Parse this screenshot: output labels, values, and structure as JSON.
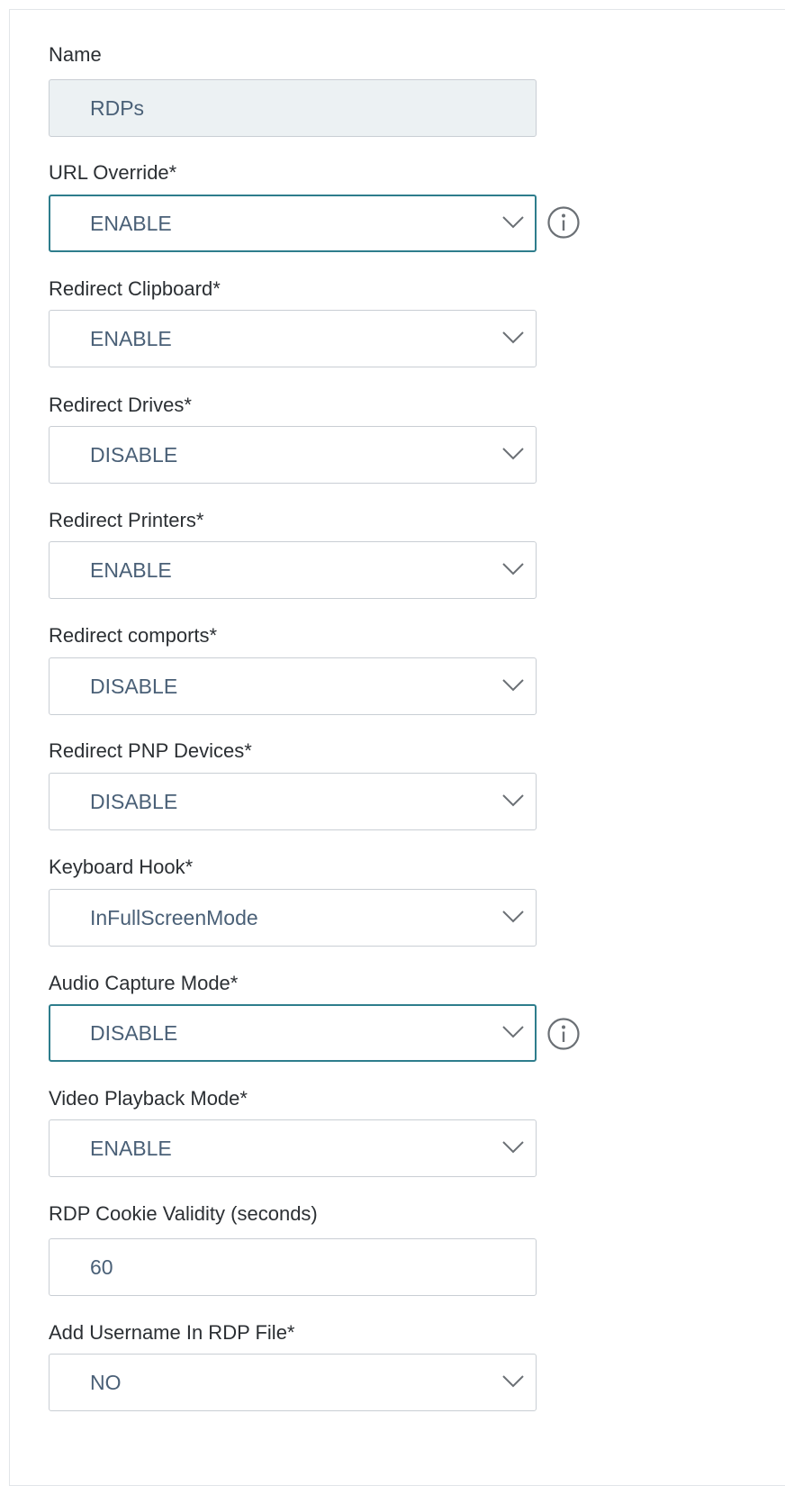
{
  "form": {
    "name": {
      "label": "Name",
      "value": "RDPs"
    },
    "url_override": {
      "label": "URL Override*",
      "value": "ENABLE"
    },
    "redirect_clipboard": {
      "label": "Redirect Clipboard*",
      "value": "ENABLE"
    },
    "redirect_drives": {
      "label": "Redirect Drives*",
      "value": "DISABLE"
    },
    "redirect_printers": {
      "label": "Redirect Printers*",
      "value": "ENABLE"
    },
    "redirect_comports": {
      "label": "Redirect comports*",
      "value": "DISABLE"
    },
    "redirect_pnp_devices": {
      "label": "Redirect PNP Devices*",
      "value": "DISABLE"
    },
    "keyboard_hook": {
      "label": "Keyboard Hook*",
      "value": "InFullScreenMode"
    },
    "audio_capture_mode": {
      "label": "Audio Capture Mode*",
      "value": "DISABLE"
    },
    "video_playback_mode": {
      "label": "Video Playback Mode*",
      "value": "ENABLE"
    },
    "rdp_cookie_validity": {
      "label": "RDP Cookie Validity (seconds)",
      "value": "60"
    },
    "add_username_in_rdp_file": {
      "label": "Add Username In RDP File*",
      "value": "NO"
    }
  },
  "icons": {
    "dropdown": "chevron-down-icon",
    "help": "info-icon"
  },
  "colors": {
    "focus_border": "#2e7d8c",
    "value_text": "#4a6077",
    "label_text": "#2b2f33",
    "readonly_bg": "#ecf1f3",
    "border": "#c9ced4",
    "icon": "#6b7075"
  }
}
